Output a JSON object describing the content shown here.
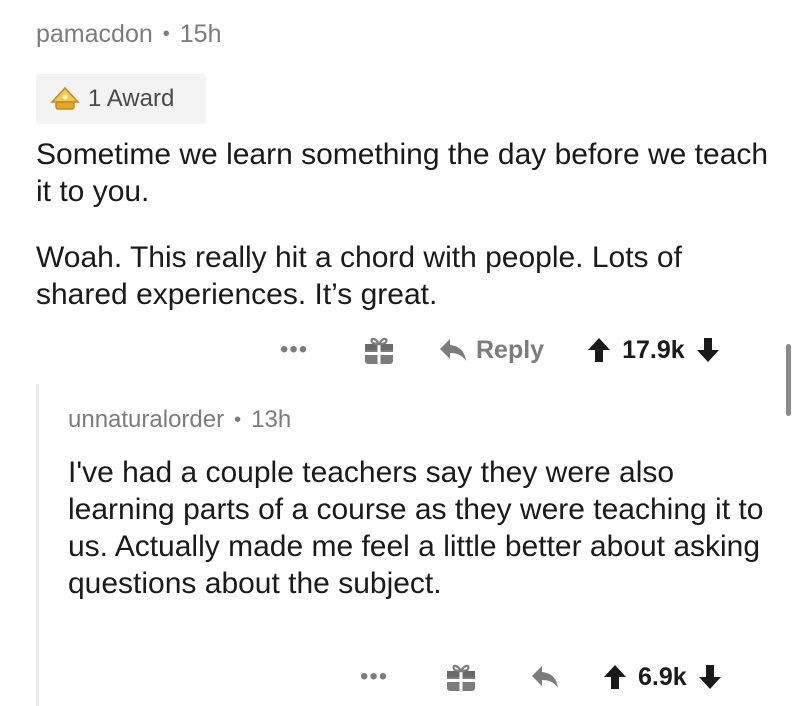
{
  "comment": {
    "author": "pamacdon",
    "separator": "•",
    "age": "15h",
    "award_label": "1 Award",
    "paragraphs": [
      "Sometime we learn something the day before we teach it to you.",
      "Woah.  This really hit a chord with people. Lots of shared experiences. It’s great."
    ],
    "actions": {
      "more": "•••",
      "reply_label": "Reply",
      "score": "17.9k"
    }
  },
  "reply": {
    "author": "unnaturalorder",
    "separator": "•",
    "age": "13h",
    "body": "I've had a couple teachers say they were also learning parts of a course as they were teaching it to us. Actually made me feel a little better about asking questions about the subject.",
    "actions": {
      "more": "•••",
      "score": "6.9k"
    }
  },
  "icons": {
    "award": "award-icon",
    "gift": "gift-icon",
    "reply": "reply-arrow-icon",
    "upvote": "upvote-arrow-icon",
    "downvote": "downvote-arrow-icon",
    "more": "more-options-icon"
  },
  "colors": {
    "meta_text": "#7c7c7c",
    "body_text": "#1a1a1b",
    "award_bg": "#f3f3f3",
    "award_gold": "#f2c94c"
  }
}
